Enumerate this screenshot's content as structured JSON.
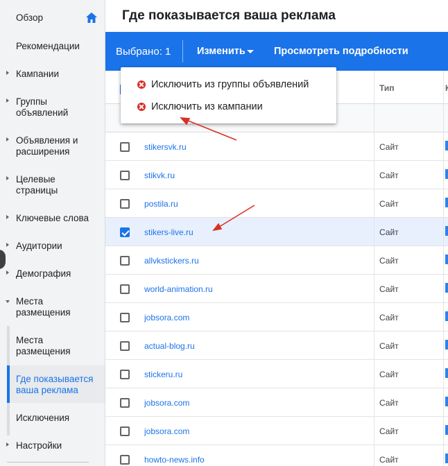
{
  "sidebar": {
    "items": [
      {
        "label": "Обзор"
      },
      {
        "label": "Рекомендации"
      },
      {
        "label": "Кампании"
      },
      {
        "label": "Группы\nобъявлений"
      },
      {
        "label": "Объявления и\nрасширения"
      },
      {
        "label": "Целевые\nстраницы"
      },
      {
        "label": "Ключевые слова"
      },
      {
        "label": "Аудитории"
      },
      {
        "label": "Демография"
      },
      {
        "label": "Места\nразмещения"
      },
      {
        "label": "Настройки"
      }
    ],
    "sub_items": [
      {
        "label": "Места\nразмещения"
      },
      {
        "label": "Где показывается\nваша реклама"
      },
      {
        "label": "Исключения"
      }
    ]
  },
  "header": {
    "title": "Где показывается ваша реклама"
  },
  "action_bar": {
    "selected": "Выбрано: 1",
    "change": "Изменить",
    "details": "Просмотреть подробности"
  },
  "menu": {
    "items": [
      {
        "label": "Исключить из группы объявлений"
      },
      {
        "label": "Исключить из кампании"
      }
    ]
  },
  "table": {
    "columns": {
      "type": "Тип",
      "extra": "К"
    },
    "rows": [
      {
        "site": "stikersvk.ru",
        "type": "Сайт",
        "checked": false
      },
      {
        "site": "stikvk.ru",
        "type": "Сайт",
        "checked": false
      },
      {
        "site": "postila.ru",
        "type": "Сайт",
        "checked": false
      },
      {
        "site": "stikers-live.ru",
        "type": "Сайт",
        "checked": true
      },
      {
        "site": "allvkstickers.ru",
        "type": "Сайт",
        "checked": false
      },
      {
        "site": "world-animation.ru",
        "type": "Сайт",
        "checked": false
      },
      {
        "site": "jobsora.com",
        "type": "Сайт",
        "checked": false
      },
      {
        "site": "actual-blog.ru",
        "type": "Сайт",
        "checked": false
      },
      {
        "site": "stickeru.ru",
        "type": "Сайт",
        "checked": false
      },
      {
        "site": "jobsora.com",
        "type": "Сайт",
        "checked": false
      },
      {
        "site": "jobsora.com",
        "type": "Сайт",
        "checked": false
      },
      {
        "site": "howto-news.info",
        "type": "Сайт",
        "checked": false
      }
    ]
  },
  "colors": {
    "accent": "#1a73e8",
    "annotation": "#d93025"
  }
}
